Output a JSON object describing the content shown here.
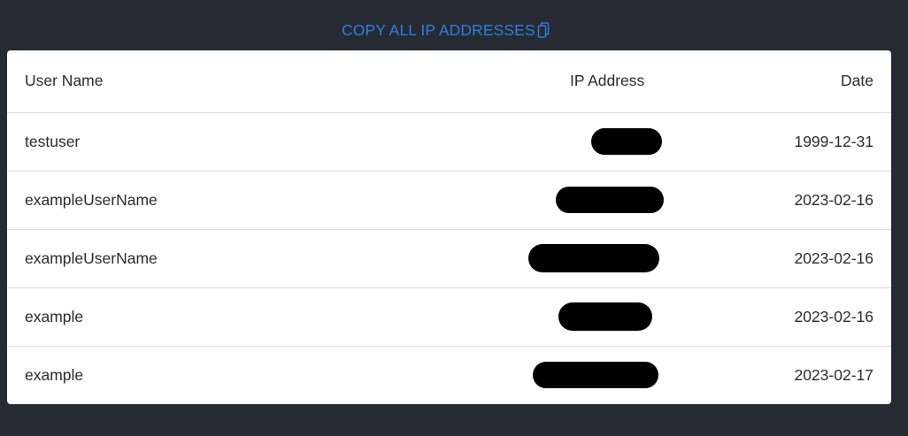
{
  "copy_all": {
    "label": "COPY ALL IP ADDRESSES",
    "icon": "clipboard-copy-icon"
  },
  "table": {
    "headers": {
      "user": "User Name",
      "ip": "IP Address",
      "date": "Date"
    },
    "rows": [
      {
        "user": "testuser",
        "ip": "",
        "date": "1999-12-31",
        "ip_redacted": true
      },
      {
        "user": "exampleUserName",
        "ip": "",
        "date": "2023-02-16",
        "ip_redacted": true
      },
      {
        "user": "exampleUserName",
        "ip": "",
        "date": "2023-02-16",
        "ip_redacted": true
      },
      {
        "user": "example",
        "ip": "",
        "date": "2023-02-16",
        "ip_redacted": true
      },
      {
        "user": "example",
        "ip": "",
        "date": "2023-02-17",
        "ip_redacted": true
      }
    ]
  },
  "colors": {
    "background": "#262a33",
    "accent": "#2f7fe0",
    "card": "#ffffff",
    "redaction": "#000000"
  }
}
